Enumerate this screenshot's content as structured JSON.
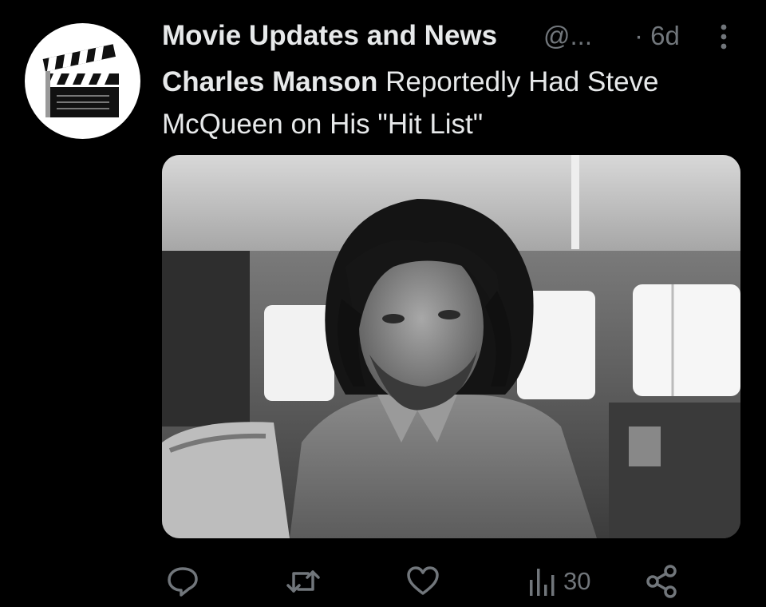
{
  "tweet": {
    "author": {
      "display_name": "Movie Updates and News",
      "handle": "@...",
      "avatar_icon": "clapperboard-icon"
    },
    "separator": "·",
    "time": "6d",
    "text": {
      "bold": "Charles Manson",
      "rest": " Reportedly Had Steve McQueen on His \"Hit List\""
    },
    "media": {
      "kind": "black-and-white photo"
    },
    "actions": {
      "reply_icon": "reply-icon",
      "retweet_icon": "retweet-icon",
      "like_icon": "heart-icon",
      "views_icon": "views-chart-icon",
      "views_count": "30",
      "share_icon": "share-icon"
    }
  },
  "colors": {
    "background": "#000000",
    "primary_text": "#e7e9ea",
    "secondary_text": "#71767b"
  }
}
